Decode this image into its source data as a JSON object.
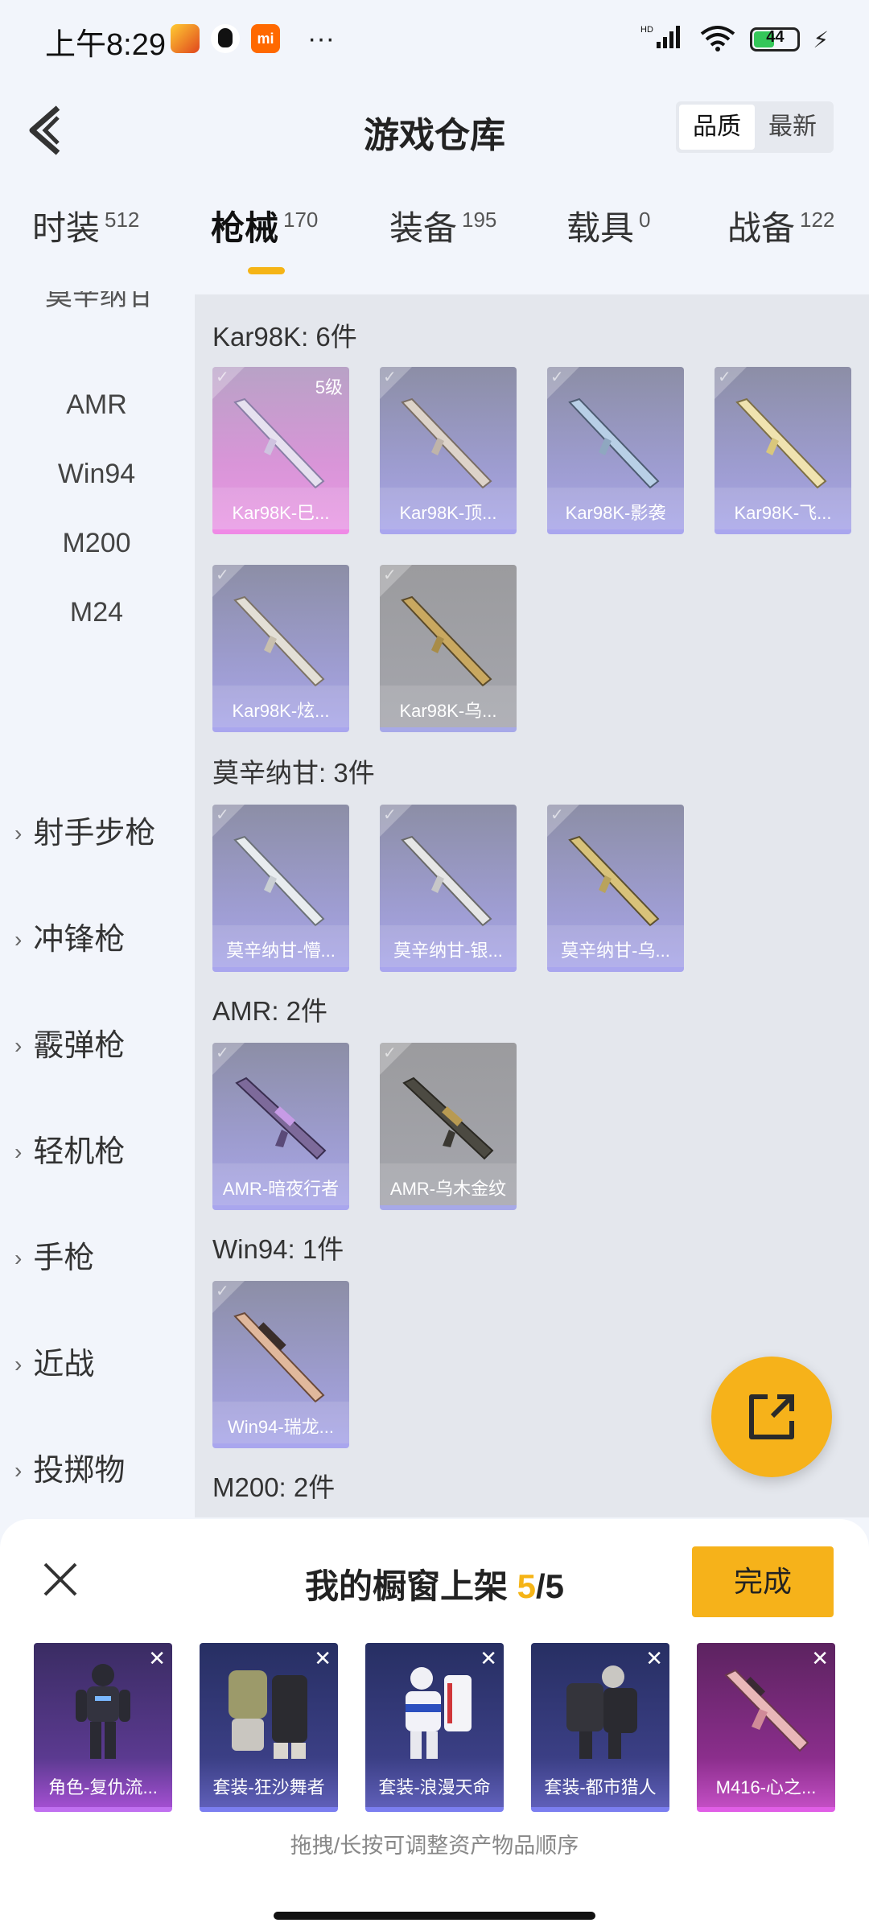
{
  "status_bar": {
    "time": "上午8:29",
    "mi_label": "mi",
    "more": "···",
    "signal": "HD",
    "battery": "44"
  },
  "header": {
    "title": "游戏仓库",
    "sort_options": [
      "品质",
      "最新"
    ],
    "active_sort": "品质"
  },
  "tabs": [
    {
      "label": "时装",
      "count": "512"
    },
    {
      "label": "枪械",
      "count": "170",
      "active": true
    },
    {
      "label": "装备",
      "count": "195"
    },
    {
      "label": "载具",
      "count": "0"
    },
    {
      "label": "战备",
      "count": "122"
    }
  ],
  "sidebar": {
    "partial_item": "莫辛纳甘",
    "sub_items": [
      "AMR",
      "Win94",
      "M200",
      "M24"
    ],
    "groups": [
      "射手步枪",
      "冲锋枪",
      "霰弹枪",
      "轻机枪",
      "手枪",
      "近战",
      "投掷物"
    ]
  },
  "sections": [
    {
      "title": "Kar98K: 6件",
      "items": [
        {
          "name": "Kar98K-巳...",
          "rarity": "pink",
          "level": "5级"
        },
        {
          "name": "Kar98K-顶...",
          "rarity": "purple"
        },
        {
          "name": "Kar98K-影袭",
          "rarity": "purple"
        },
        {
          "name": "Kar98K-飞...",
          "rarity": "purple"
        },
        {
          "name": "Kar98K-炫...",
          "rarity": "purple"
        },
        {
          "name": "Kar98K-乌...",
          "rarity": "gray"
        }
      ]
    },
    {
      "title": "莫辛纳甘: 3件",
      "items": [
        {
          "name": "莫辛纳甘-懵...",
          "rarity": "purple"
        },
        {
          "name": "莫辛纳甘-银...",
          "rarity": "purple"
        },
        {
          "name": "莫辛纳甘-乌...",
          "rarity": "purple"
        }
      ]
    },
    {
      "title": "AMR: 2件",
      "items": [
        {
          "name": "AMR-暗夜行者",
          "rarity": "purple"
        },
        {
          "name": "AMR-乌木金纹",
          "rarity": "gray"
        }
      ]
    },
    {
      "title": "Win94: 1件",
      "items": [
        {
          "name": "Win94-瑞龙...",
          "rarity": "purple"
        }
      ]
    },
    {
      "title": "M200: 2件",
      "items": []
    }
  ],
  "sheet": {
    "title": "我的橱窗上架",
    "count_current": "5",
    "count_total": "/5",
    "done_label": "完成",
    "hint": "拖拽/长按可调整资产物品顺序",
    "items": [
      {
        "label": "角色-复仇流...",
        "tone": "violet"
      },
      {
        "label": "套装-狂沙舞者",
        "tone": "indigo"
      },
      {
        "label": "套装-浪漫天命",
        "tone": "indigo"
      },
      {
        "label": "套装-都市猎人",
        "tone": "indigo"
      },
      {
        "label": "M416-心之...",
        "tone": "magenta"
      }
    ]
  },
  "colors": {
    "accent": "#f6b21a",
    "background": "#f2f5fb",
    "content_bg": "#e4e7ed"
  }
}
